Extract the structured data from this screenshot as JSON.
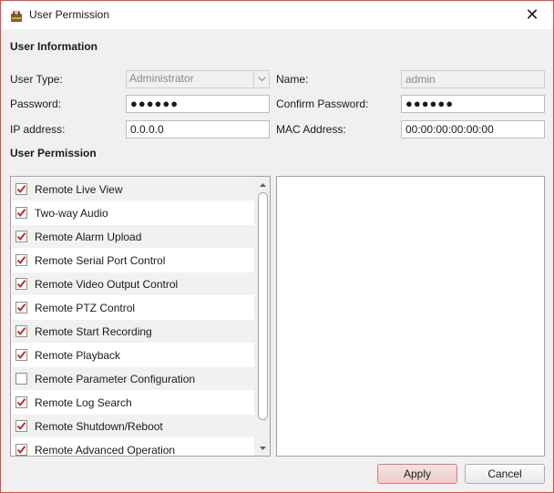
{
  "window": {
    "title": "User Permission",
    "close_glyph": "✕",
    "border_color": "#e24a4a"
  },
  "user_info": {
    "section_title": "User Information",
    "user_type_label": "User Type:",
    "user_type_value": "Administrator",
    "name_label": "Name:",
    "name_value": "admin",
    "password_label": "Password:",
    "password_value": "●●●●●●",
    "confirm_password_label": "Confirm Password:",
    "confirm_password_value": "●●●●●●",
    "ip_label": "IP address:",
    "ip_value": "0.0.0.0",
    "mac_label": "MAC Address:",
    "mac_value": "00:00:00:00:00:00"
  },
  "permissions": {
    "section_title": "User Permission",
    "items": [
      {
        "label": "Remote Live View",
        "checked": true
      },
      {
        "label": "Two-way Audio",
        "checked": true
      },
      {
        "label": "Remote Alarm Upload",
        "checked": true
      },
      {
        "label": "Remote Serial Port Control",
        "checked": true
      },
      {
        "label": "Remote Video Output Control",
        "checked": true
      },
      {
        "label": "Remote PTZ Control",
        "checked": true
      },
      {
        "label": "Remote Start Recording",
        "checked": true
      },
      {
        "label": "Remote Playback",
        "checked": true
      },
      {
        "label": "Remote Parameter Configuration",
        "checked": false
      },
      {
        "label": "Remote Log Search",
        "checked": true
      },
      {
        "label": "Remote Shutdown/Reboot",
        "checked": true
      },
      {
        "label": "Remote Advanced Operation",
        "checked": true
      }
    ],
    "check_color": "#c62828"
  },
  "buttons": {
    "apply": "Apply",
    "cancel": "Cancel"
  }
}
